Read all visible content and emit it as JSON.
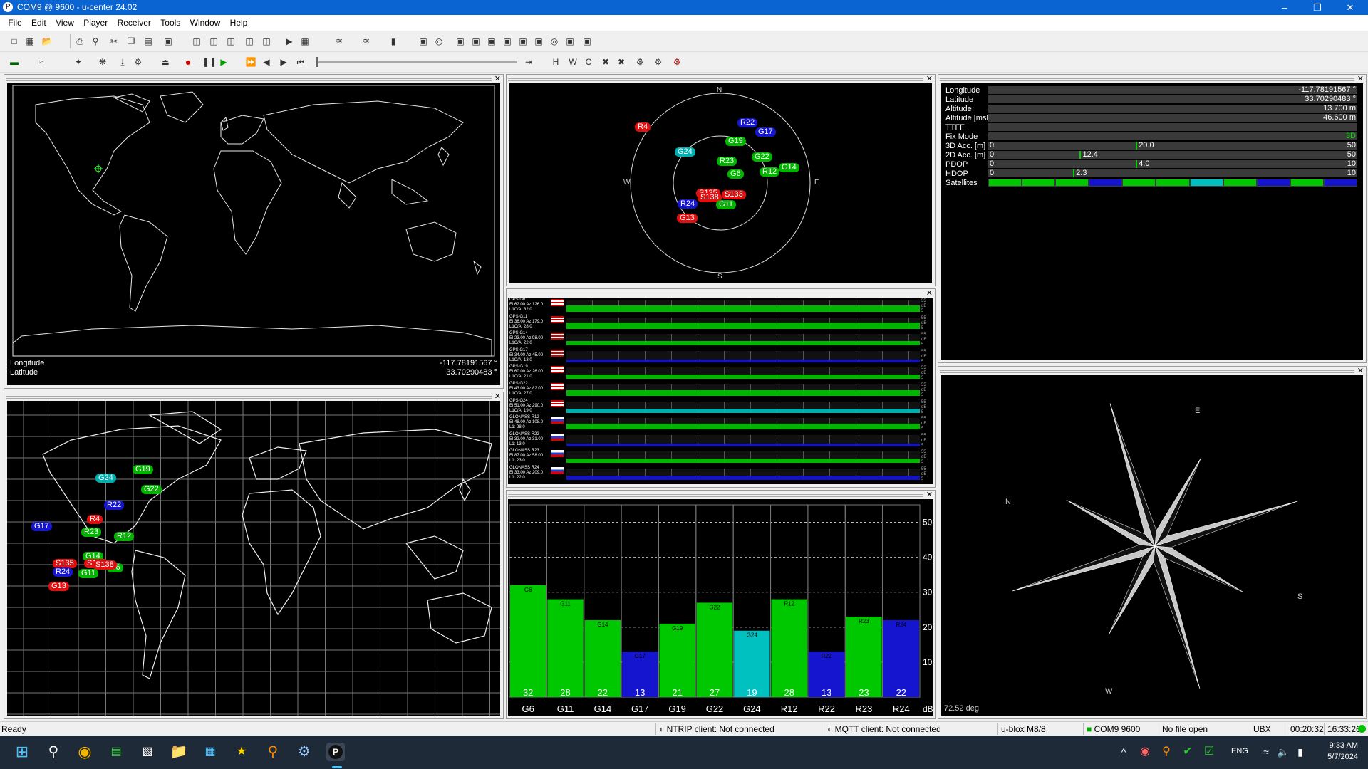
{
  "window": {
    "title": "COM9 @ 9600 - u-center 24.02",
    "app_icon": "P"
  },
  "menu": [
    "File",
    "Edit",
    "View",
    "Player",
    "Receiver",
    "Tools",
    "Window",
    "Help"
  ],
  "map_panel": {
    "longitude_label": "Longitude",
    "longitude_value": "-117.78191567 °",
    "latitude_label": "Latitude",
    "latitude_value": "33.70290483 °"
  },
  "sky_view": {
    "compass": [
      "N",
      "E",
      "S",
      "W"
    ],
    "satellites": [
      {
        "id": "R4",
        "color": "red"
      },
      {
        "id": "R22",
        "color": "blue"
      },
      {
        "id": "G17",
        "color": "blue"
      },
      {
        "id": "G19",
        "color": "green"
      },
      {
        "id": "G24",
        "color": "cyan"
      },
      {
        "id": "G22",
        "color": "green"
      },
      {
        "id": "R23",
        "color": "green"
      },
      {
        "id": "R12",
        "color": "green"
      },
      {
        "id": "G14",
        "color": "green"
      },
      {
        "id": "G6",
        "color": "green"
      },
      {
        "id": "S135",
        "color": "red"
      },
      {
        "id": "S133",
        "color": "red"
      },
      {
        "id": "S138",
        "color": "red"
      },
      {
        "id": "R24",
        "color": "blue"
      },
      {
        "id": "G11",
        "color": "green"
      },
      {
        "id": "G13",
        "color": "red"
      }
    ]
  },
  "signal_history": {
    "rows": [
      {
        "name": "GPS G6",
        "detail": "El 62.00 Az 126.0",
        "sub": "L1C/A: 32.0"
      },
      {
        "name": "GPS G11",
        "detail": "El 36.00 Az 179.0",
        "sub": "L1C/A: 28.0"
      },
      {
        "name": "GPS G14",
        "detail": "El 23.00 Az 98.00",
        "sub": "L1C/A: 22.0"
      },
      {
        "name": "GPS G17",
        "detail": "El 34.00 Az 45.00",
        "sub": "L1C/A: 13.0"
      },
      {
        "name": "GPS G19",
        "detail": "El 60.00 Az 26.00",
        "sub": "L1C/A: 21.0"
      },
      {
        "name": "GPS G22",
        "detail": "El 43.00 Az 82.00",
        "sub": "L1C/A: 27.0"
      },
      {
        "name": "GPS G24",
        "detail": "El 51.00 Az 290.0",
        "sub": "L1C/A: 19.0"
      },
      {
        "name": "GLONASS R12",
        "detail": "El 48.00 Az 108.0",
        "sub": "L1: 28.0"
      },
      {
        "name": "GLONASS R22",
        "detail": "El 32.00 Az 31.00",
        "sub": "L1: 13.0"
      },
      {
        "name": "GLONASS R23",
        "detail": "El 87.00 Az 58.00",
        "sub": "L1: 23.0"
      },
      {
        "name": "GLONASS R24",
        "detail": "El 33.00 Az 209.0",
        "sub": "L1: 22.0"
      }
    ],
    "scale_top": "55",
    "scale_bottom": "5",
    "unit": "dB"
  },
  "chart_data": {
    "type": "bar",
    "categories": [
      "G6",
      "G11",
      "G14",
      "G17",
      "G19",
      "G22",
      "G24",
      "R12",
      "R22",
      "R23",
      "R24"
    ],
    "values": [
      32,
      28,
      22,
      13,
      21,
      27,
      19,
      28,
      13,
      23,
      22
    ],
    "colors": [
      "#00c800",
      "#00c800",
      "#00c800",
      "#1515d0",
      "#00c800",
      "#00c800",
      "#00c0c0",
      "#00c800",
      "#1515d0",
      "#00c800",
      "#1515d0"
    ],
    "yticks": [
      10,
      20,
      30,
      40,
      50
    ],
    "ylim": [
      0,
      55
    ],
    "unit": "dB"
  },
  "data_view": {
    "rows": [
      {
        "label": "Longitude",
        "value": "-117.78191567 °"
      },
      {
        "label": "Latitude",
        "value": "33.70290483 °"
      },
      {
        "label": "Altitude",
        "value": "13.700 m"
      },
      {
        "label": "Altitude [msl]",
        "value": "46.600 m"
      },
      {
        "label": "TTFF",
        "value": ""
      },
      {
        "label": "Fix Mode",
        "value": "3D"
      },
      {
        "label": "3D Acc. [m]",
        "min": "0",
        "mid": "20.0",
        "max": "50",
        "frac": 0.4
      },
      {
        "label": "2D Acc. [m]",
        "min": "0",
        "mid": "12.4",
        "max": "50",
        "frac": 0.248
      },
      {
        "label": "PDOP",
        "min": "0",
        "mid": "4.0",
        "max": "10",
        "frac": 0.4
      },
      {
        "label": "HDOP",
        "min": "0",
        "mid": "2.3",
        "max": "10",
        "frac": 0.23
      },
      {
        "label": "Satellites",
        "value": ""
      }
    ],
    "sat_colors": [
      "#00c800",
      "#00c800",
      "#00c800",
      "#1515d0",
      "#00c800",
      "#00c800",
      "#00c0c0",
      "#00c800",
      "#1515d0",
      "#00c800",
      "#1515d0"
    ]
  },
  "compass": {
    "labels": [
      "E",
      "N",
      "S",
      "W"
    ],
    "heading": "72.52 deg"
  },
  "status_bar": {
    "ready": "Ready",
    "ntrip": "NTRIP client: Not connected",
    "mqtt": "MQTT client: Not connected",
    "receiver": "u-blox M8/8",
    "port": "COM9 9600",
    "file": "No file open",
    "protocol": "UBX",
    "elapsed": "00:20:32",
    "clock": "16:33:26"
  },
  "taskbar": {
    "lang": "ENG",
    "time": "9:33 AM",
    "date": "5/7/2024"
  }
}
